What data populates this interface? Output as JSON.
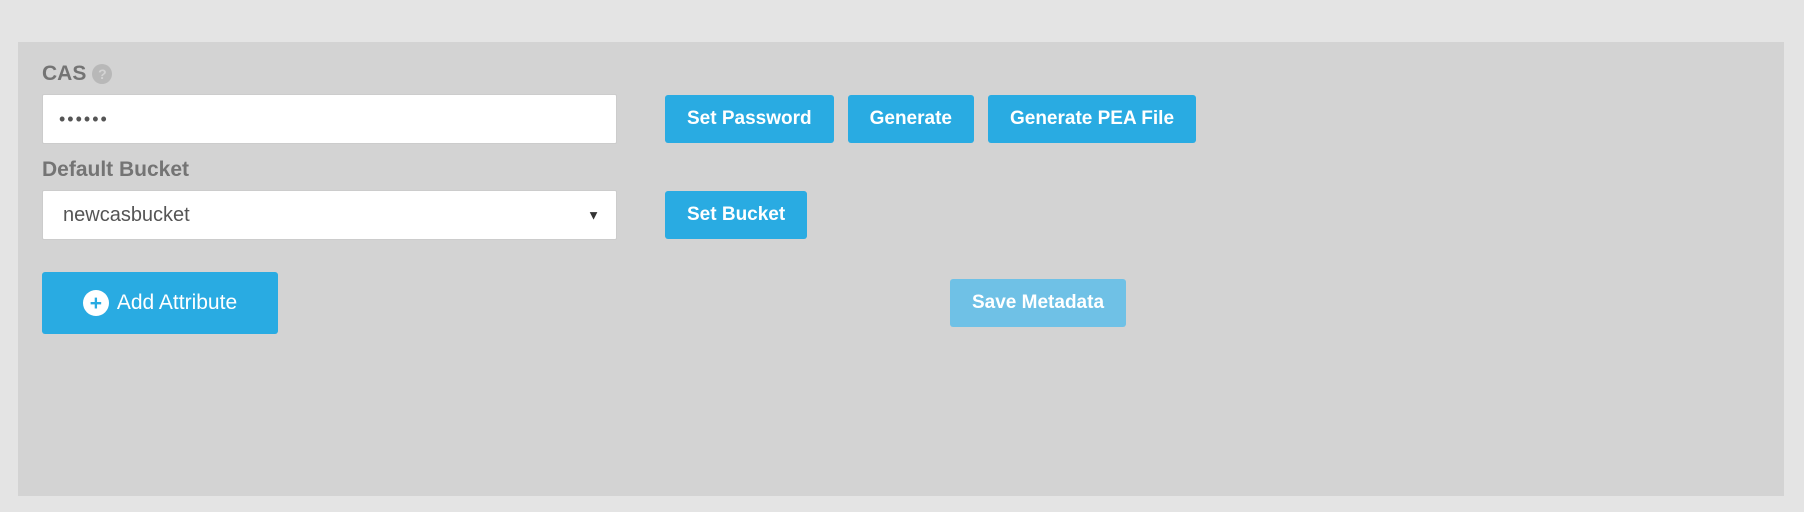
{
  "cas": {
    "label": "CAS",
    "password_value": "••••••",
    "buttons": {
      "set_password": "Set Password",
      "generate": "Generate",
      "generate_pea": "Generate PEA File"
    }
  },
  "bucket": {
    "label": "Default Bucket",
    "selected": "newcasbucket",
    "set_button": "Set Bucket"
  },
  "actions": {
    "add_attribute": "Add Attribute",
    "save_metadata": "Save Metadata"
  }
}
